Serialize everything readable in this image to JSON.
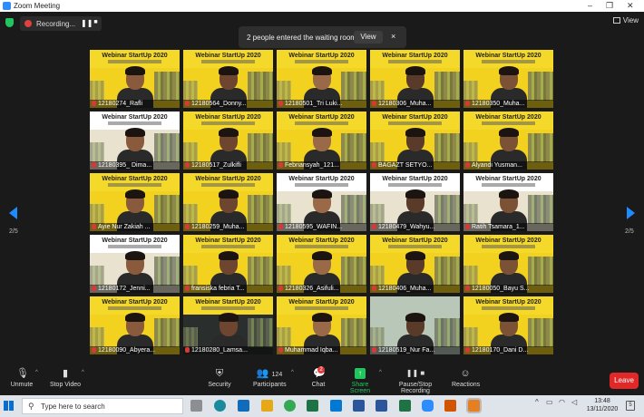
{
  "window": {
    "title": "Zoom Meeting",
    "controls": [
      "–",
      "❐",
      "✕"
    ]
  },
  "meeting": {
    "recording_label": "Recording...",
    "view_label": "View",
    "notification": {
      "text": "2 people entered the waiting room",
      "button": "View",
      "close": "×"
    },
    "page_left": "2/5",
    "page_right": "2/5"
  },
  "banner": {
    "title": "Webinar StartUp 2020"
  },
  "participants": [
    {
      "name": "12180274_Rafli",
      "muted": true,
      "style": "yellow"
    },
    {
      "name": "12180564_Donny...",
      "muted": true,
      "style": "yellow"
    },
    {
      "name": "12180501_Tri Luki...",
      "muted": true,
      "style": "yellow"
    },
    {
      "name": "12180306_Muha...",
      "muted": true,
      "style": "yellow"
    },
    {
      "name": "12180350_Muha...",
      "muted": true,
      "style": "yellow"
    },
    {
      "name": "12180395_ Dima...",
      "muted": true,
      "style": "white"
    },
    {
      "name": "12180517_Zulkifli",
      "muted": true,
      "style": "yellow"
    },
    {
      "name": "Febriansyah_121...",
      "muted": true,
      "style": "yellow"
    },
    {
      "name": "BAGAZT SETYO...",
      "muted": true,
      "style": "yellow"
    },
    {
      "name": "Alyandi Yusman...",
      "muted": true,
      "style": "yellow"
    },
    {
      "name": "Ayie Nur Zakiah ...",
      "muted": true,
      "style": "yellow"
    },
    {
      "name": "12180259_Muha...",
      "muted": true,
      "style": "yellow"
    },
    {
      "name": "12180595_WAFIN...",
      "muted": true,
      "style": "white"
    },
    {
      "name": "12180479_Wahyu...",
      "muted": true,
      "style": "white"
    },
    {
      "name": "Ratih Tsamara_1...",
      "muted": true,
      "style": "white"
    },
    {
      "name": "12180172_Jenni...",
      "muted": true,
      "style": "white"
    },
    {
      "name": "fransiska febria T...",
      "muted": true,
      "style": "yellow"
    },
    {
      "name": "12180326_Asifuli...",
      "muted": true,
      "style": "yellow"
    },
    {
      "name": "12180406_Muha...",
      "muted": true,
      "style": "yellow"
    },
    {
      "name": "12180050_Bayu S...",
      "muted": true,
      "style": "yellow"
    },
    {
      "name": "12180090_Abyera...",
      "muted": true,
      "style": "yellow"
    },
    {
      "name": "12180280_Lamsa...",
      "muted": true,
      "style": "dark"
    },
    {
      "name": "Muhammad Iqba...",
      "muted": true,
      "style": "yellow"
    },
    {
      "name": "12180519_Nur Fa...",
      "muted": true,
      "style": "outdoor"
    },
    {
      "name": "12180170_Dani D...",
      "muted": true,
      "style": "yellow"
    }
  ],
  "toolbar": {
    "unmute": "Unmute",
    "stop_video": "Stop Video",
    "security": "Security",
    "participants": "Participants",
    "participants_count": "124",
    "chat": "Chat",
    "chat_badge": "2",
    "share_screen": "Share Screen",
    "pause_recording": "Pause/Stop Recording",
    "reactions": "Reactions",
    "leave": "Leave"
  },
  "taskbar": {
    "search_placeholder": "Type here to search",
    "time": "13:48",
    "date": "13/11/2020",
    "notification_count": "5"
  },
  "colors": {
    "accent_blue": "#1e8cff",
    "share_green": "#21c55d",
    "leave_red": "#e02828",
    "tile_yellow": "#f2d21e"
  }
}
